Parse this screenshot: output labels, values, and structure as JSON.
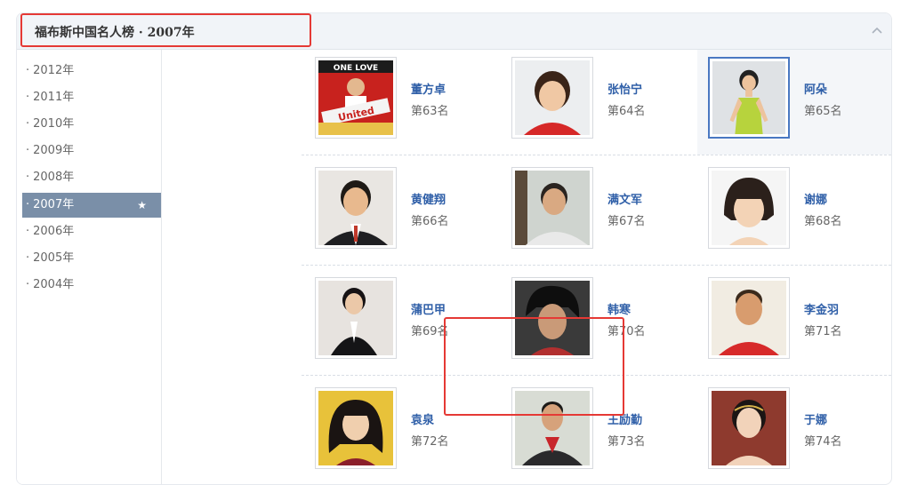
{
  "header": {
    "title": "福布斯中国名人榜 · 2007年"
  },
  "sidebar": {
    "items": [
      {
        "label": "2012年",
        "active": false
      },
      {
        "label": "2011年",
        "active": false
      },
      {
        "label": "2010年",
        "active": false
      },
      {
        "label": "2009年",
        "active": false
      },
      {
        "label": "2008年",
        "active": false
      },
      {
        "label": "2007年",
        "active": true
      },
      {
        "label": "2006年",
        "active": false
      },
      {
        "label": "2005年",
        "active": false
      },
      {
        "label": "2004年",
        "active": false
      }
    ],
    "bullet": "·",
    "star": "★"
  },
  "people": [
    {
      "name": "董方卓",
      "rank": "第63名"
    },
    {
      "name": "张怡宁",
      "rank": "第64名"
    },
    {
      "name": "阿朵",
      "rank": "第65名"
    },
    {
      "name": "黄健翔",
      "rank": "第66名"
    },
    {
      "name": "满文军",
      "rank": "第67名"
    },
    {
      "name": "谢娜",
      "rank": "第68名"
    },
    {
      "name": "蒲巴甲",
      "rank": "第69名"
    },
    {
      "name": "韩寒",
      "rank": "第70名"
    },
    {
      "name": "李金羽",
      "rank": "第71名"
    },
    {
      "name": "袁泉",
      "rank": "第72名"
    },
    {
      "name": "王励勤",
      "rank": "第73名"
    },
    {
      "name": "于娜",
      "rank": "第74名"
    }
  ],
  "photo_text": {
    "magazine_line1": "ONE LOVE",
    "magazine_line2": "United"
  },
  "colors": {
    "accent_link": "#2f5fa8",
    "active_bg": "#7a8fa8",
    "highlight": "#e53935"
  }
}
